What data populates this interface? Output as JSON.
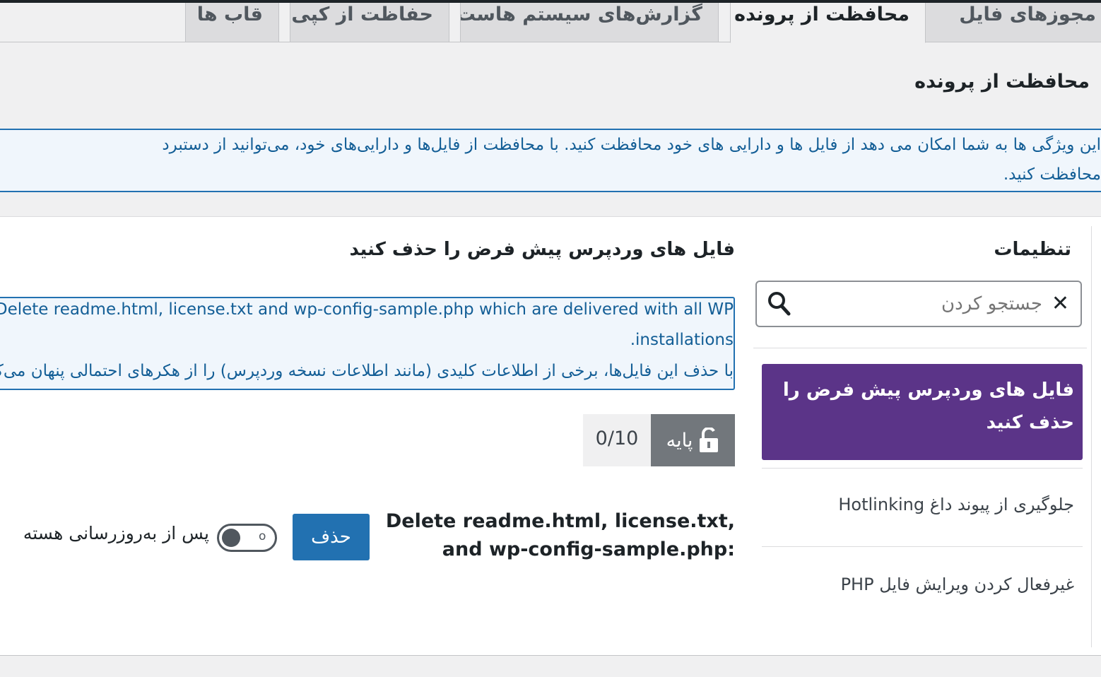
{
  "tabs": [
    {
      "label": "مجوزهای فایل",
      "active": false
    },
    {
      "label": "محافظت از پرونده",
      "active": true
    },
    {
      "label": "گزارش‌های سیستم هاست",
      "active": false
    },
    {
      "label": "حفاظت از کپی",
      "active": false
    },
    {
      "label": "قاب ها",
      "active": false
    }
  ],
  "page_title": "محافظت از پرونده",
  "notice": {
    "line1": "این ویژگی ها به شما امکان می دهد از فایل ها و دارایی های خود محافظت کنید. با محافظت از فایل‌ها و دارایی‌های خود، می‌توانید از دستبرد",
    "line2": "محافظت کنید."
  },
  "sidebar": {
    "title": "تنظیمات",
    "search_placeholder": "جستجو کردن",
    "items": [
      {
        "label": "فایل های وردپرس پیش فرض را حذف کنید",
        "active": true
      },
      {
        "label": "جلوگیری از پیوند داغ Hotlinking",
        "active": false
      },
      {
        "label": "غیرفعال کردن ویرایش فایل PHP",
        "active": false
      }
    ]
  },
  "main": {
    "title": "فایل های وردپرس پیش فرض را حذف کنید",
    "info_line1": "Delete readme.html, license.txt and wp-config-sample.php which are delivered with all WP",
    "info_line2": "installations.",
    "info_line3": "با حذف این فایل‌ها، برخی از اطلاعات کلیدی (مانند اطلاعات نسخه وردپرس) را از هکرهای احتمالی پنهان می‌کنید.",
    "level_label": "پایه",
    "score": "0/10",
    "delete_label": "Delete readme.html, license.txt, and wp-config-sample.php:",
    "delete_button": "حذف",
    "toggle_state": "o",
    "toggle_label": "پس از به‌روزرسانی هسته"
  },
  "colors": {
    "accent_purple": "#5b3488",
    "button_blue": "#2271b1",
    "notice_bg": "#f0f6fc",
    "level_grey": "#72777c"
  }
}
